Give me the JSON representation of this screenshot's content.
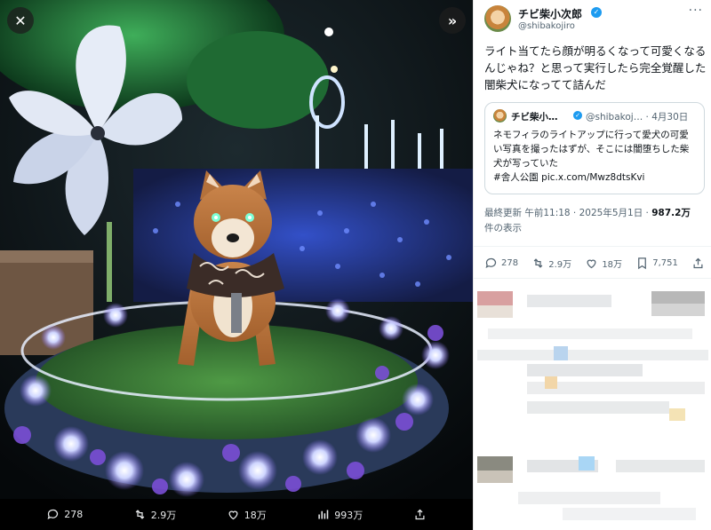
{
  "viewer": {
    "close_icon": "close-icon",
    "expand_icon": "expand-chevrons-icon",
    "stats": [
      {
        "icon": "reply-icon",
        "value": "278"
      },
      {
        "icon": "retweet-icon",
        "value": "2.9万"
      },
      {
        "icon": "heart-icon",
        "value": "18万"
      },
      {
        "icon": "views-icon",
        "value": "993万"
      },
      {
        "icon": "share-icon",
        "value": ""
      }
    ]
  },
  "tweet": {
    "display_name": "チビ柴小次郎",
    "handle": "@shibakojiro",
    "text": "ライト当てたら顔が明るくなって可愛くなるんじゃね？と思って実行したら完全覚醒した闇柴犬になってて詰んだ",
    "quote": {
      "display_name": "チビ柴小…",
      "handle": "@shibakoj…",
      "date": "· 4月30日",
      "text": "ネモフィラのライトアップに行って愛犬の可愛い写真を撮ったはずが、そこには闇堕ちした柴犬が写っていた",
      "hashtag": "#舎人公園",
      "link": "pic.x.com/Mwz8dtsKvi"
    },
    "meta": {
      "edited": "最終更新 午前11:18 · 2025年5月1日 · ",
      "views": "987.2万",
      "views_label": "件の表示"
    },
    "actions": [
      {
        "icon": "reply-icon",
        "value": "278"
      },
      {
        "icon": "retweet-icon",
        "value": "2.9万"
      },
      {
        "icon": "heart-icon",
        "value": "18万"
      },
      {
        "icon": "bookmark-icon",
        "value": "7,751"
      },
      {
        "icon": "share-icon",
        "value": ""
      }
    ]
  },
  "colors": {
    "verified": "#1d9bf0",
    "text_primary": "#0f1419",
    "text_secondary": "#536471"
  }
}
